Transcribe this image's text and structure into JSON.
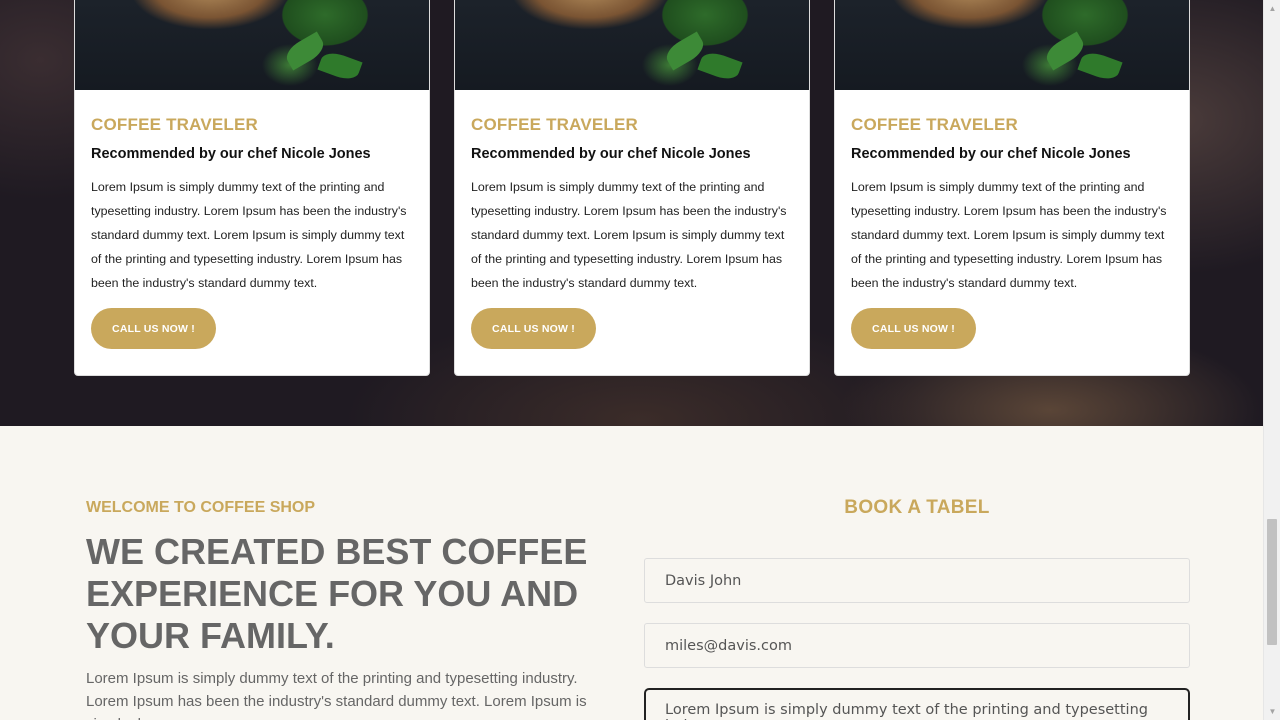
{
  "cards": [
    {
      "title": "COFFEE TRAVELER",
      "subtitle": "Recommended by our chef Nicole Jones",
      "text": "Lorem Ipsum is simply dummy text of the printing and typesetting industry. Lorem Ipsum has been the industry's standard dummy text. Lorem Ipsum is simply dummy text of the printing and typesetting industry. Lorem Ipsum has been the industry's standard dummy text.",
      "button": "CALL US NOW !"
    },
    {
      "title": "COFFEE TRAVELER",
      "subtitle": "Recommended by our chef Nicole Jones",
      "text": "Lorem Ipsum is simply dummy text of the printing and typesetting industry. Lorem Ipsum has been the industry's standard dummy text. Lorem Ipsum is simply dummy text of the printing and typesetting industry. Lorem Ipsum has been the industry's standard dummy text.",
      "button": "CALL US NOW !"
    },
    {
      "title": "COFFEE TRAVELER",
      "subtitle": "Recommended by our chef Nicole Jones",
      "text": "Lorem Ipsum is simply dummy text of the printing and typesetting industry. Lorem Ipsum has been the industry's standard dummy text. Lorem Ipsum is simply dummy text of the printing and typesetting industry. Lorem Ipsum has been the industry's standard dummy text.",
      "button": "CALL US NOW !"
    }
  ],
  "welcome": {
    "label": "WELCOME TO COFFEE SHOP",
    "headline": "WE CREATED BEST COFFEE EXPERIENCE FOR YOU AND YOUR FAMILY.",
    "text": "Lorem Ipsum is simply dummy text of the printing and typesetting industry. Lorem Ipsum has been the industry's standard dummy text. Lorem Ipsum is simply dummy"
  },
  "booking": {
    "title": "BOOK A TABEL",
    "name_value": "Davis John",
    "email_value": "miles@davis.com",
    "message_value": "Lorem Ipsum is simply dummy text of the printing and typesetting industry"
  },
  "colors": {
    "accent": "#c9a85c",
    "dark_bg": "#1f1a22",
    "light_bg": "#f8f6f1"
  }
}
